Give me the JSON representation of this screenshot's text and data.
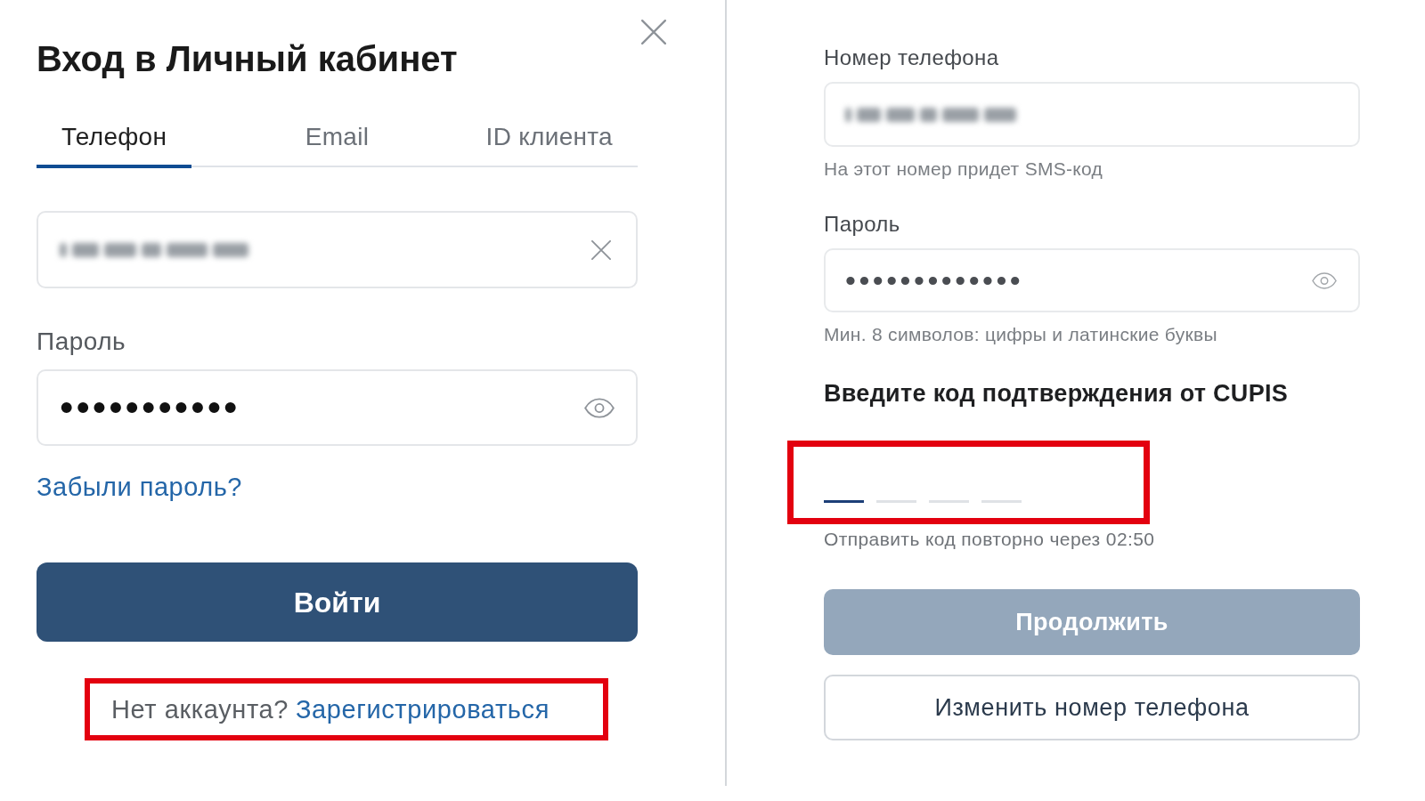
{
  "login_dialog": {
    "title": "Вход в Личный кабинет",
    "tabs": [
      {
        "label": "Телефон",
        "selected": true
      },
      {
        "label": "Email",
        "selected": false
      },
      {
        "label": "ID клиента",
        "selected": false
      }
    ],
    "phone_field": {
      "blurred": true
    },
    "password_field": {
      "label": "Пароль",
      "value": "•••••••••••"
    },
    "forgot_link": "Забыли пароль?",
    "submit_button": "Войти",
    "register_prompt": {
      "text": "Нет аккаунта?",
      "link": "Зарегистрироваться",
      "highlighted": true
    }
  },
  "registration_form": {
    "phone_field": {
      "label": "Номер телефона",
      "blurred": true,
      "hint": "На этот номер придет SMS-код"
    },
    "password_field": {
      "label": "Пароль",
      "value": "•••••••••••••",
      "hint": "Мин. 8 символов: цифры и латинские буквы"
    },
    "code": {
      "heading": "Введите код подтверждения от CUPIS",
      "highlighted": true,
      "cells": [
        {
          "focused": true
        },
        {
          "focused": false
        },
        {
          "focused": false
        },
        {
          "focused": false
        }
      ],
      "resend": "Отправить код повторно через 02:50"
    },
    "continue_button": {
      "label": "Продолжить",
      "disabled": true
    },
    "change_phone_button": "Изменить номер телефона"
  }
}
